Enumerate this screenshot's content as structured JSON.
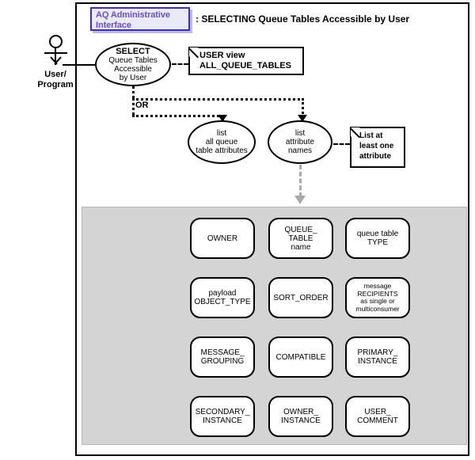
{
  "title_badge": {
    "line1": "AQ Administrative",
    "line2": "Interface"
  },
  "diagram_title": ": SELECTING Queue Tables Accessible by User",
  "actor": {
    "label_line1": "User/",
    "label_line2": "Program",
    "icon": "stick-figure-actor-icon"
  },
  "use_cases": [
    {
      "id": "select-queue-tables",
      "bold_line": "SELECT",
      "lines": [
        "Queue Tables",
        "Accessible",
        "by User"
      ]
    },
    {
      "id": "list-all-queue-table-attributes",
      "lines": [
        "list",
        "all queue",
        "table attributes"
      ]
    },
    {
      "id": "list-attribute-names",
      "lines": [
        "list",
        "attribute",
        "names"
      ]
    }
  ],
  "notes": [
    {
      "id": "user-view-note",
      "lines": [
        "USER view",
        "ALL_QUEUE_TABLES"
      ]
    },
    {
      "id": "least-one-attribute-note",
      "lines": [
        "List at",
        "least one",
        "attribute"
      ]
    }
  ],
  "or_label": "OR",
  "attributes_panel": {
    "rows": [
      [
        {
          "id": "owner",
          "lines": [
            "OWNER"
          ],
          "small": false
        },
        {
          "id": "queue-table-name",
          "lines": [
            "QUEUE_",
            "TABLE",
            "name"
          ],
          "small": false
        },
        {
          "id": "queue-table-type",
          "lines": [
            "queue table",
            "TYPE"
          ],
          "small": false
        }
      ],
      [
        {
          "id": "payload-object-type",
          "lines": [
            "payload",
            "OBJECT_TYPE"
          ],
          "small": false
        },
        {
          "id": "sort-order",
          "lines": [
            "SORT_ORDER"
          ],
          "small": false
        },
        {
          "id": "message-recipients",
          "lines": [
            "message",
            "RECIPIENTS",
            "as single or",
            "multiconsumer"
          ],
          "small": true
        }
      ],
      [
        {
          "id": "message-grouping",
          "lines": [
            "MESSAGE_",
            "GROUPING"
          ],
          "small": false
        },
        {
          "id": "compatible",
          "lines": [
            "COMPATIBLE"
          ],
          "small": false
        },
        {
          "id": "primary-instance",
          "lines": [
            "PRIMARY_",
            "INSTANCE"
          ],
          "small": false
        }
      ],
      [
        {
          "id": "secondary-instance",
          "lines": [
            "SECONDARY_",
            "INSTANCE"
          ],
          "small": false
        },
        {
          "id": "owner-instance",
          "lines": [
            "OWNER_",
            "INSTANCE"
          ],
          "small": false
        },
        {
          "id": "user-comment",
          "lines": [
            "USER_",
            "COMMENT"
          ],
          "small": false
        }
      ]
    ]
  },
  "colors": {
    "badge_fill": "#e9e9f7",
    "badge_border": "#3d2db5",
    "badge_text": "#6a4fc0",
    "panel_fill": "#d4d4d4",
    "grey_arrow": "#a8a8a8",
    "line": "#000000"
  }
}
